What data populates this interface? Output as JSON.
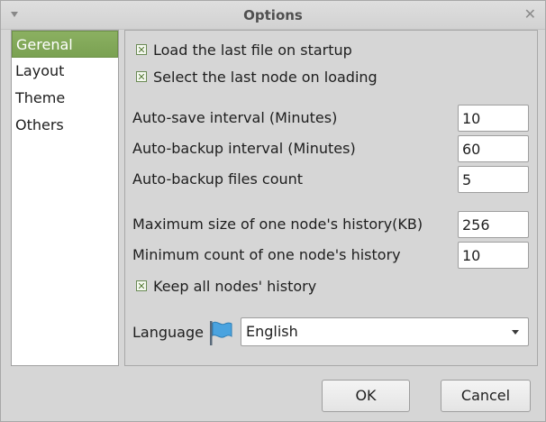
{
  "window": {
    "title": "Options"
  },
  "sidebar": {
    "items": [
      {
        "label": "Gerenal",
        "selected": true
      },
      {
        "label": "Layout",
        "selected": false
      },
      {
        "label": "Theme",
        "selected": false
      },
      {
        "label": "Others",
        "selected": false
      }
    ]
  },
  "general": {
    "load_last_file": {
      "label": "Load the last file on startup",
      "checked": true
    },
    "select_last_node": {
      "label": "Select the last node on loading",
      "checked": true
    },
    "autosave_interval": {
      "label": "Auto-save interval (Minutes)",
      "value": "10"
    },
    "autobackup_interval": {
      "label": "Auto-backup interval (Minutes)",
      "value": "60"
    },
    "autobackup_count": {
      "label": "Auto-backup files count",
      "value": "5"
    },
    "max_history_size": {
      "label": "Maximum size of one node's history(KB)",
      "value": "256"
    },
    "min_history_count": {
      "label": "Minimum count of one node's history",
      "value": "10"
    },
    "keep_all_history": {
      "label": "Keep all nodes' history",
      "checked": true
    },
    "language": {
      "label": "Language",
      "value": "English",
      "icon": "flag-icon"
    }
  },
  "buttons": {
    "ok": "OK",
    "cancel": "Cancel"
  },
  "colors": {
    "selected_bg": "#7aa152",
    "window_bg": "#d6d6d6",
    "flag": "#4aa3df"
  }
}
